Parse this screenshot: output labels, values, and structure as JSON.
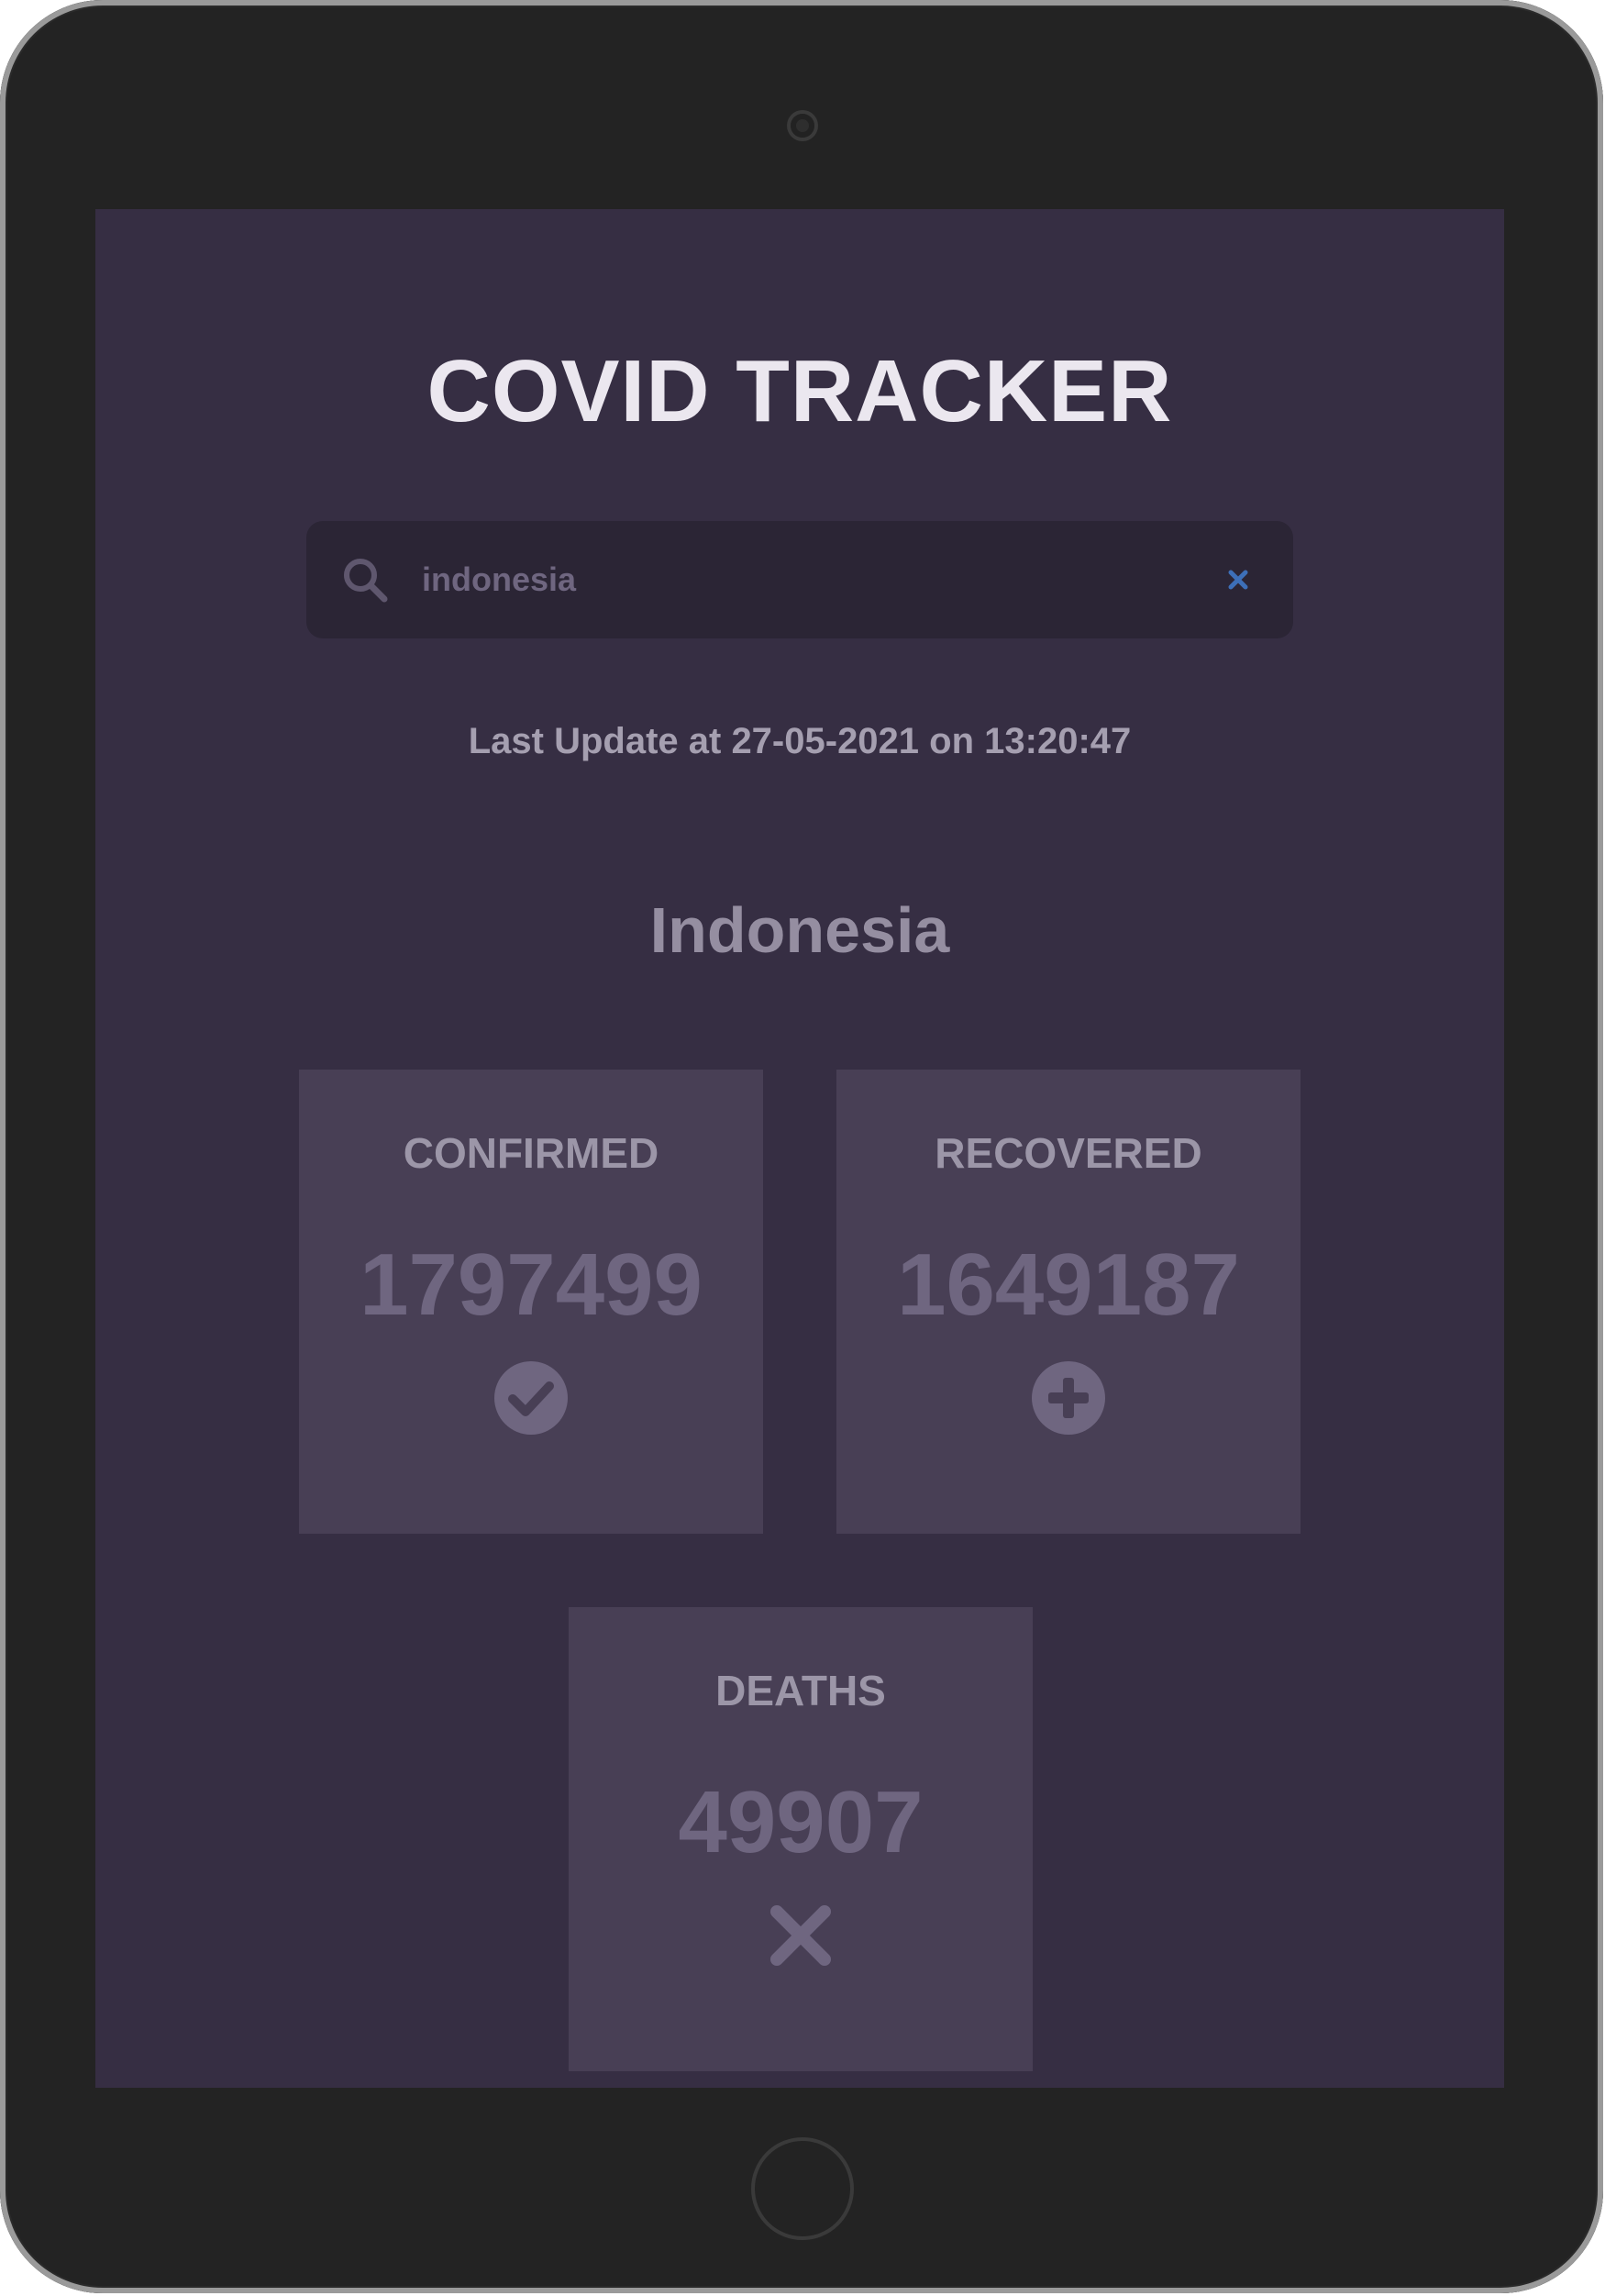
{
  "app": {
    "title": "COVID TRACKER"
  },
  "search": {
    "value": "indonesia",
    "icon": "search-icon",
    "clear_icon": "close-icon"
  },
  "status": {
    "last_update": "Last Update at 27-05-2021 on 13:20:47"
  },
  "country": {
    "name": "Indonesia"
  },
  "stats": {
    "confirmed": {
      "label": "CONFIRMED",
      "value": "1797499",
      "icon": "check-circle-icon"
    },
    "recovered": {
      "label": "RECOVERED",
      "value": "1649187",
      "icon": "plus-circle-icon"
    },
    "deaths": {
      "label": "DEATHS",
      "value": "49907",
      "icon": "x-icon"
    }
  },
  "colors": {
    "background": "#362e43",
    "card": "#483f55",
    "search_bg": "#2b2535",
    "title": "#ebe7ef",
    "clear_accent": "#3d6fb8"
  }
}
